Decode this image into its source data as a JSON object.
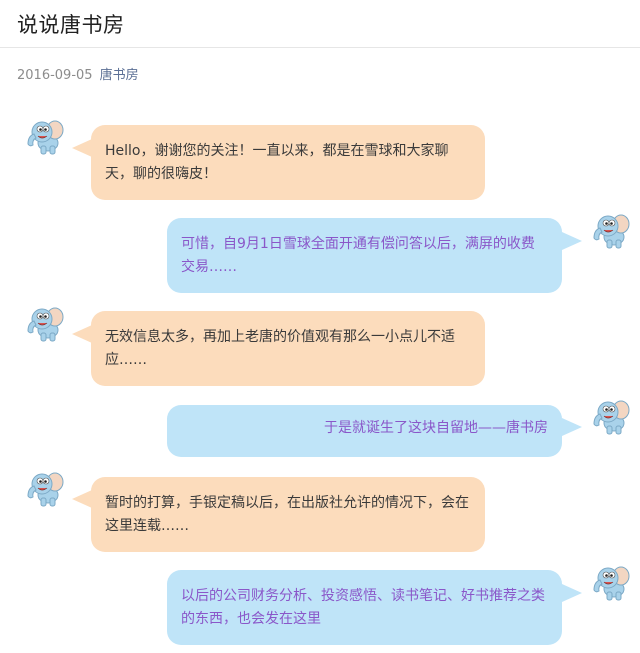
{
  "article": {
    "title": "说说唐书房",
    "date": "2016-09-05",
    "author": "唐书房"
  },
  "messages": [
    {
      "side": "left",
      "avatar": "elephant-avatar-icon",
      "text": "Hello，谢谢您的关注！一直以来，都是在雪球和大家聊天，聊的很嗨皮！"
    },
    {
      "side": "right",
      "avatar": "elephant-avatar-icon",
      "text": "可惜，自9月1日雪球全面开通有偿问答以后，满屏的收费交易……"
    },
    {
      "side": "left",
      "avatar": "elephant-avatar-icon",
      "text": "无效信息太多，再加上老唐的价值观有那么一小点儿不适应……"
    },
    {
      "side": "right",
      "avatar": "elephant-avatar-icon",
      "text": "于是就诞生了这块自留地——唐书房"
    },
    {
      "side": "left",
      "avatar": "elephant-avatar-icon",
      "text": "暂时的打算，手银定稿以后，在出版社允许的情况下，会在这里连载……"
    },
    {
      "side": "right",
      "avatar": "elephant-avatar-icon",
      "text": "以后的公司财务分析、投资感悟、读书笔记、好书推荐之类的东西，也会发在这里"
    }
  ],
  "colors": {
    "left_bubble": "#fcdcbc",
    "right_bubble": "#bfe4f8",
    "right_text": "#8a57c9",
    "elephant": "#a9d2ea"
  }
}
